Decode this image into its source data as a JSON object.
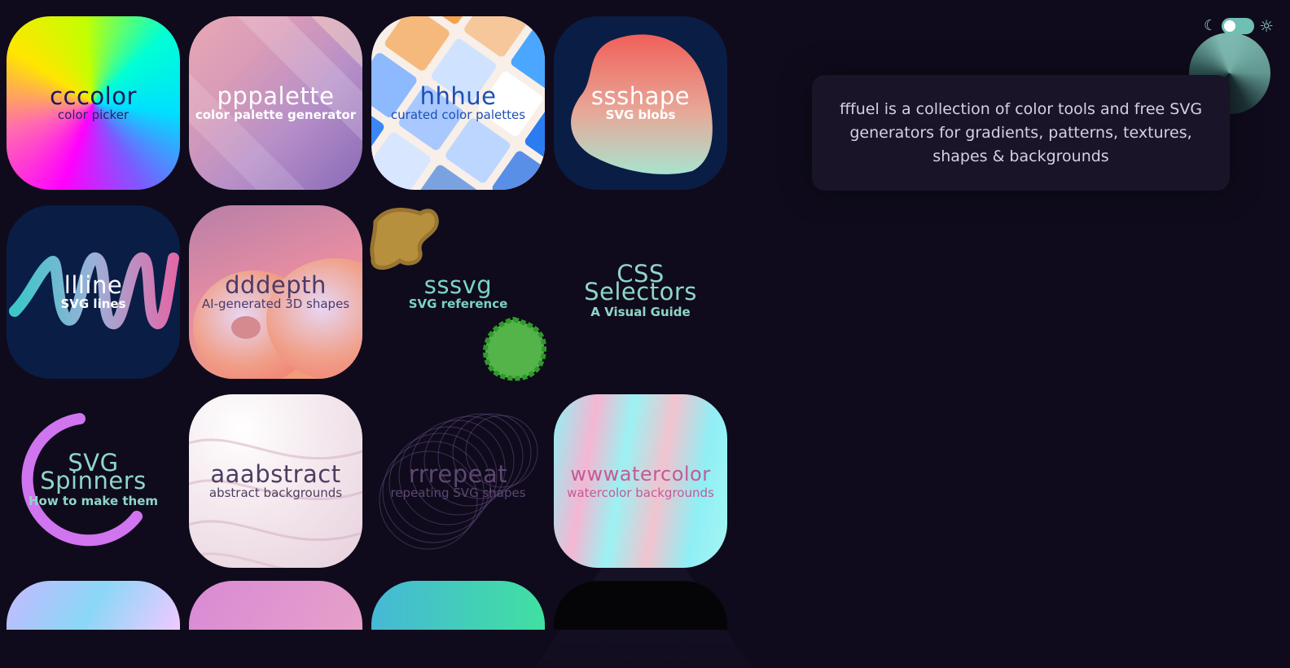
{
  "tiles": [
    {
      "title": "cccolor",
      "subtitle": "color picker"
    },
    {
      "title": "pppalette",
      "subtitle": "color palette generator"
    },
    {
      "title": "hhhue",
      "subtitle": "curated color palettes"
    },
    {
      "title": "ssshape",
      "subtitle": "SVG blobs"
    },
    {
      "title": "llline",
      "subtitle": "SVG lines"
    },
    {
      "title": "dddepth",
      "subtitle": "AI-generated 3D shapes"
    },
    {
      "title": "sssvg",
      "subtitle": "SVG reference"
    },
    {
      "title_line1": "CSS",
      "title_line2": "Selectors",
      "subtitle": "A Visual Guide"
    },
    {
      "title_line1": "SVG",
      "title_line2": "Spinners",
      "subtitle": "How to make them"
    },
    {
      "title": "aaabstract",
      "subtitle": "abstract backgrounds"
    },
    {
      "title": "rrrepeat",
      "subtitle": "repeating SVG shapes"
    },
    {
      "title": "wwwatercolor",
      "subtitle": "watercolor backgrounds"
    }
  ],
  "info": {
    "text": "fffuel is a collection of color tools and free SVG generators for gradients, patterns, textures, shapes & backgrounds"
  },
  "theme_toggle": {
    "moon_icon": "moon-icon",
    "sun_icon": "sun-icon",
    "state": "dark"
  },
  "colors": {
    "background": "#0f0b1c",
    "accent": "#8fd6c8"
  }
}
